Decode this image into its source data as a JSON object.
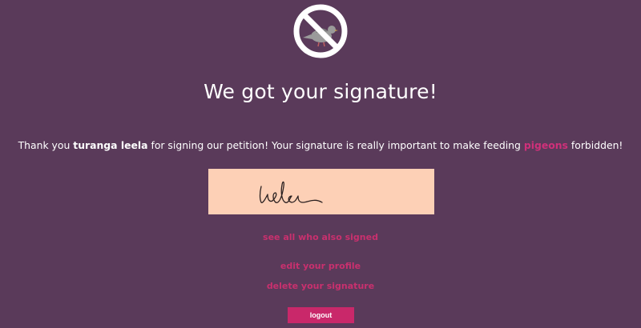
{
  "header": {
    "logo_icon": "no-pigeon-icon"
  },
  "main": {
    "title": "We got your signature!",
    "thanks": {
      "prefix": "Thank you ",
      "name": "turanga leela",
      "middle": " for signing our petition! Your signature is really important to make feeding ",
      "highlight": "pigeons",
      "suffix": " forbidden!"
    },
    "signature": {
      "background": "#fdd0b6"
    }
  },
  "links": {
    "see_all": "see all who also signed",
    "edit_profile": "edit your profile",
    "delete_signature": "delete your signature"
  },
  "buttons": {
    "logout": "logout"
  },
  "colors": {
    "background": "#5a3a5a",
    "accent": "#c9306e",
    "text": "#ffffff"
  }
}
